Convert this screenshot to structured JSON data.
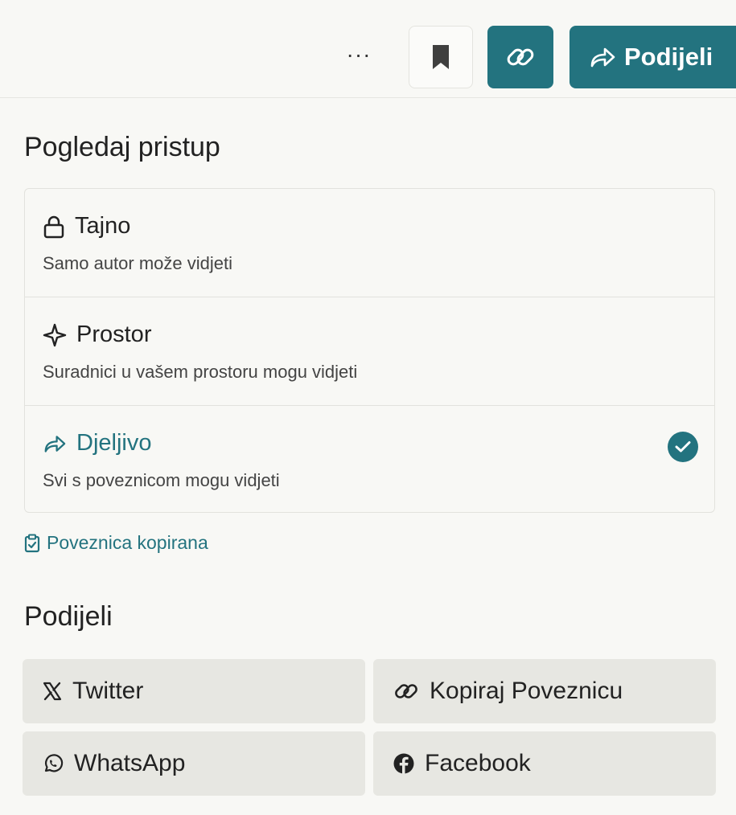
{
  "toolbar": {
    "more_label": "···",
    "share_label": "Podijeli",
    "icons": {
      "more": "more-horizontal-icon",
      "bookmark": "bookmark-icon",
      "link": "link-icon",
      "share": "share-arrow-icon"
    },
    "accent": "#23737f"
  },
  "access": {
    "title": "Pogledaj pristup",
    "options": [
      {
        "label": "Tajno",
        "description": "Samo autor može vidjeti",
        "icon": "lock-icon",
        "selected": false
      },
      {
        "label": "Prostor",
        "description": "Suradnici u vašem prostoru mogu vidjeti",
        "icon": "sparkle-icon",
        "selected": false
      },
      {
        "label": "Djeljivo",
        "description": "Svi s poveznicom mogu vidjeti",
        "icon": "share-arrow-icon",
        "selected": true
      }
    ],
    "copied_notice": "Poveznica kopirana"
  },
  "share": {
    "title": "Podijeli",
    "buttons": [
      {
        "label": "Twitter",
        "icon": "x-twitter-icon"
      },
      {
        "label": "Kopiraj Poveznicu",
        "icon": "link-icon"
      },
      {
        "label": "WhatsApp",
        "icon": "whatsapp-icon"
      },
      {
        "label": "Facebook",
        "icon": "facebook-icon"
      }
    ]
  }
}
